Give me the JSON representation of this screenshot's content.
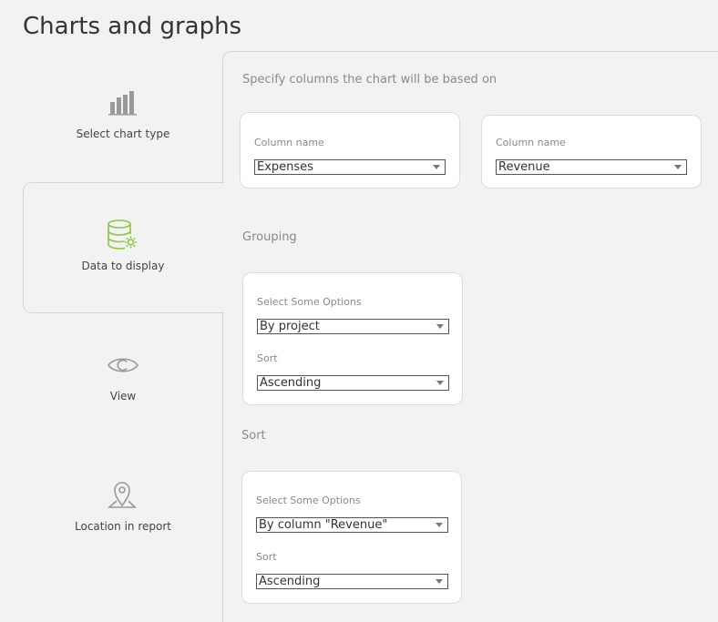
{
  "page": {
    "title": "Charts and graphs"
  },
  "steps": [
    {
      "label": "Select chart type",
      "icon": "bar-chart-icon",
      "active": false
    },
    {
      "label": "Data to display",
      "icon": "database-settings-icon",
      "active": true
    },
    {
      "label": "View",
      "icon": "eye-icon",
      "active": false
    },
    {
      "label": "Location in report",
      "icon": "map-pin-icon",
      "active": false
    }
  ],
  "columns": {
    "heading": "Specify columns the chart will be based on",
    "cards": [
      {
        "label": "Column name",
        "value": "Expenses"
      },
      {
        "label": "Column name",
        "value": "Revenue"
      }
    ]
  },
  "grouping": {
    "heading": "Grouping",
    "options_label": "Select Some Options",
    "options_value": "By project",
    "sort_label": "Sort",
    "sort_value": "Ascending"
  },
  "sort": {
    "heading": "Sort",
    "options_label": "Select Some Options",
    "options_value": "By column \"Revenue\"",
    "sort_label": "Sort",
    "sort_value": "Ascending"
  },
  "colors": {
    "accent": "#8dc63f",
    "icon_gray": "#999999",
    "background": "#f2f2f2"
  }
}
